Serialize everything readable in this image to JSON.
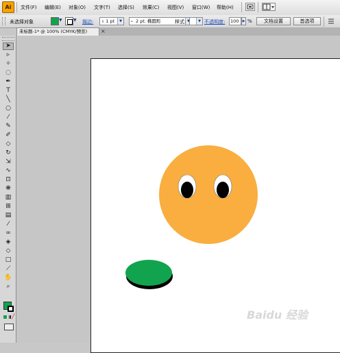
{
  "app": {
    "logo": "Ai",
    "menu": [
      "文件(F)",
      "编辑(E)",
      "对象(O)",
      "文字(T)",
      "选择(S)",
      "效果(C)",
      "视图(V)",
      "窗口(W)",
      "帮助(H)"
    ]
  },
  "control_bar": {
    "selection_label": "未选择对象",
    "fill_color": "#12a34e",
    "stroke_color": "#000000",
    "stroke_label": "描边:",
    "stroke_weight": "1 pt",
    "brush_preset": "2 pt. 椭圆形",
    "style_label": "样式:",
    "opacity_label": "不透明度:",
    "opacity_value": "100",
    "opacity_unit": "%",
    "doc_setup_button": "文档设置",
    "preferences_button": "首选项"
  },
  "document": {
    "tab_title": "未标题-1* @ 100% (CMYK/预览)",
    "tab_close": "×"
  },
  "toolbar": {
    "tools": [
      "selection-tool-icon",
      "direct-selection-tool-icon",
      "magic-wand-icon",
      "lasso-icon",
      "pen-tool-icon",
      "type-tool-icon",
      "line-tool-icon",
      "ellipse-tool-icon",
      "paintbrush-icon",
      "pencil-icon",
      "blob-brush-icon",
      "eraser-icon",
      "rotate-tool-icon",
      "scale-tool-icon",
      "warp-tool-icon",
      "free-transform-icon",
      "symbol-sprayer-icon",
      "column-graph-icon",
      "mesh-tool-icon",
      "gradient-tool-icon",
      "eyedropper-icon",
      "blend-tool-icon",
      "live-paint-bucket-icon",
      "live-paint-selection-icon",
      "artboard-tool-icon",
      "slice-tool-icon",
      "hand-tool-icon",
      "zoom-tool-icon"
    ],
    "fill_swatch": "#12a34e",
    "stroke_swatch": "#000000"
  },
  "artwork": {
    "face_color": "#f9ae3f",
    "eye_white": "#ffffff",
    "pupil_color": "#000000",
    "disc_color": "#12a34e",
    "disc_shadow": "#000000"
  },
  "watermark": "Baidu 经验"
}
